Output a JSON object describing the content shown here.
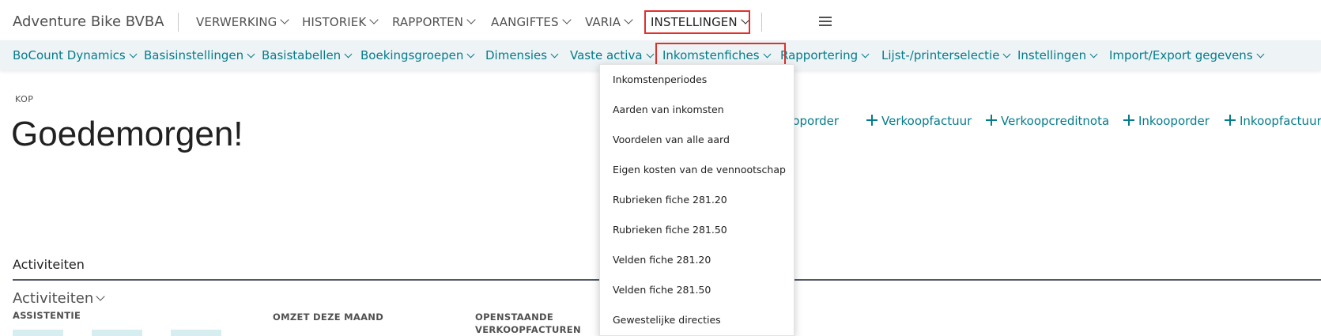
{
  "app": {
    "company": "Adventure Bike BVBA"
  },
  "top_nav": [
    {
      "label": "VERWERKING"
    },
    {
      "label": "HISTORIEK"
    },
    {
      "label": "RAPPORTEN"
    },
    {
      "label": "AANGIFTES"
    },
    {
      "label": "VARIA"
    },
    {
      "label": "INSTELLINGEN",
      "active": true
    }
  ],
  "sub_nav": [
    {
      "label": "BoCount Dynamics"
    },
    {
      "label": "Basisinstellingen"
    },
    {
      "label": "Basistabellen"
    },
    {
      "label": "Boekingsgroepen"
    },
    {
      "label": "Dimensies"
    },
    {
      "label": "Vaste activa"
    },
    {
      "label": "Inkomstenfiches",
      "active": true
    },
    {
      "label": "Rapportering"
    },
    {
      "label": "Lijst-/printerselectie"
    },
    {
      "label": "Instellingen"
    },
    {
      "label": "Import/Export gegevens"
    }
  ],
  "dropdown": {
    "items": [
      "Inkomstenperiodes",
      "Aarden van inkomsten",
      "Voordelen van alle aard",
      "Eigen kosten van de vennootschap",
      "Rubrieken fiche 281.20",
      "Rubrieken fiche 281.50",
      "Velden fiche 281.20",
      "Velden fiche 281.50",
      "Gewestelijke directies"
    ]
  },
  "header": {
    "caption": "KOP",
    "greeting": "Goedemorgen!"
  },
  "actions": [
    {
      "label": "kooporder"
    },
    {
      "label": "Verkoopfactuur"
    },
    {
      "label": "Verkoopcreditnota"
    },
    {
      "label": "Inkooporder"
    },
    {
      "label": "Inkoopfactuur"
    }
  ],
  "activities": {
    "section_title": "Activiteiten",
    "group_title": "Activiteiten",
    "cues": {
      "assistentie": "ASSISTENTIE",
      "omzet": "OMZET DEZE MAAND",
      "openstaande": "OPENSTAANDE VERKOOPFACTUREN"
    }
  },
  "colors": {
    "accent": "#047c8b",
    "highlight_box": "#e0302a",
    "subnav_bg": "#eef3f6"
  }
}
